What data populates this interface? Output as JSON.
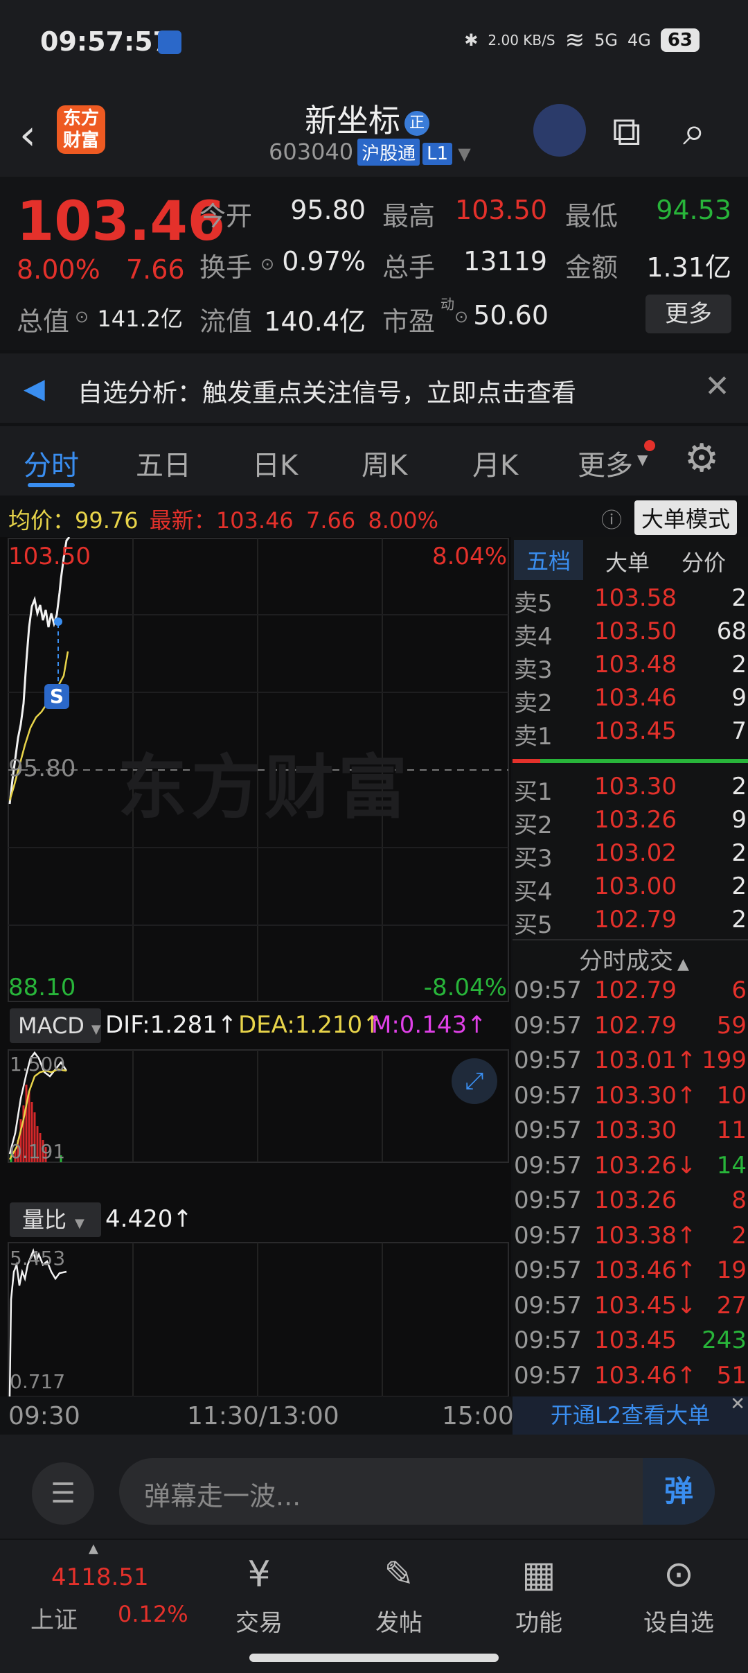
{
  "status_bar": {
    "time": "09:57:57",
    "net_speed": "2.00 KB/S",
    "signal_5g": "5G",
    "signal_4g": "4G",
    "battery": "63"
  },
  "header": {
    "title": "新坐标",
    "badge": "正",
    "code": "603040",
    "tag1": "沪股通",
    "tag2": "L1"
  },
  "logo": {
    "line1": "东方",
    "line2": "财富"
  },
  "quote": {
    "price": "103.46",
    "change_pct": "8.00%",
    "change": "7.66",
    "open_label": "今开",
    "open": "95.80",
    "high_label": "最高",
    "high": "103.50",
    "low_label": "最低",
    "low": "94.53",
    "turnover_label": "换手",
    "turnover": "0.97%",
    "volume_label": "总手",
    "volume": "13119",
    "amount_label": "金额",
    "amount": "1.31亿",
    "mktcap_label": "总值",
    "mktcap": "141.2亿",
    "float_label": "流值",
    "float": "140.4亿",
    "pe_label": "市盈",
    "pe_sup": "动",
    "pe": "50.60",
    "more": "更多"
  },
  "notice": {
    "text": "自选分析：触发重点关注信号，立即点击查看"
  },
  "tabs": [
    "分时",
    "五日",
    "日K",
    "周K",
    "月K",
    "更多"
  ],
  "info_bar": {
    "avg_label": "均价：",
    "avg": "99.76",
    "latest_label": "最新：",
    "latest": "103.46",
    "chg": "7.66",
    "pct": "8.00%",
    "mode": "大单模式"
  },
  "chart": {
    "top_price": "103.50",
    "top_pct": "8.04%",
    "mid_price": "95.80",
    "bottom_price": "88.10",
    "bottom_pct": "-8.04%",
    "watermark": "东方财富",
    "signal": "S",
    "macd_label": "MACD",
    "dif": "DIF:1.281↑",
    "dea": "DEA:1.210↑",
    "m": "M:0.143↑",
    "macd_top": "1.500",
    "macd_bottom": "0.191",
    "vr_label": "量比",
    "vr": "4.420↑",
    "vr_top": "5.453",
    "vr_bottom": "0.717",
    "x_start": "09:30",
    "x_mid": "11:30/13:00",
    "x_end": "15:00"
  },
  "orderbook": {
    "tabs": [
      "五档",
      "大单",
      "分价"
    ],
    "sells": [
      {
        "label": "卖5",
        "price": "103.58",
        "vol": "2"
      },
      {
        "label": "卖4",
        "price": "103.50",
        "vol": "68"
      },
      {
        "label": "卖3",
        "price": "103.48",
        "vol": "2"
      },
      {
        "label": "卖2",
        "price": "103.46",
        "vol": "9"
      },
      {
        "label": "卖1",
        "price": "103.45",
        "vol": "7"
      }
    ],
    "buys": [
      {
        "label": "买1",
        "price": "103.30",
        "vol": "2"
      },
      {
        "label": "买2",
        "price": "103.26",
        "vol": "9"
      },
      {
        "label": "买3",
        "price": "103.02",
        "vol": "2"
      },
      {
        "label": "买4",
        "price": "103.00",
        "vol": "2"
      },
      {
        "label": "买5",
        "price": "102.79",
        "vol": "2"
      }
    ],
    "trades_title": "分时成交",
    "trades": [
      {
        "time": "09:57",
        "price": "102.79",
        "vol": "6",
        "vc": "red"
      },
      {
        "time": "09:57",
        "price": "102.79",
        "vol": "59",
        "vc": "red"
      },
      {
        "time": "09:57",
        "price": "103.01↑",
        "vol": "199",
        "vc": "red"
      },
      {
        "time": "09:57",
        "price": "103.30↑",
        "vol": "10",
        "vc": "red"
      },
      {
        "time": "09:57",
        "price": "103.30",
        "vol": "11",
        "vc": "red"
      },
      {
        "time": "09:57",
        "price": "103.26↓",
        "vol": "14",
        "vc": "green"
      },
      {
        "time": "09:57",
        "price": "103.26",
        "vol": "8",
        "vc": "red"
      },
      {
        "time": "09:57",
        "price": "103.38↑",
        "vol": "2",
        "vc": "red"
      },
      {
        "time": "09:57",
        "price": "103.46↑",
        "vol": "19",
        "vc": "red"
      },
      {
        "time": "09:57",
        "price": "103.45↓",
        "vol": "27",
        "vc": "red"
      },
      {
        "time": "09:57",
        "price": "103.45",
        "vol": "243",
        "vc": "green"
      },
      {
        "time": "09:57",
        "price": "103.46↑",
        "vol": "51",
        "vc": "red"
      }
    ],
    "l2": "开通L2查看大单"
  },
  "comment": {
    "placeholder": "弹幕走一波...",
    "dan": "弹"
  },
  "bottom_nav": {
    "index_value": "4118.51",
    "index_name": "上证",
    "index_pct": "0.12%",
    "items": [
      "交易",
      "发帖",
      "功能",
      "设自选"
    ]
  },
  "colors": {
    "up": "#e4312b",
    "down": "#28b53a",
    "accent": "#3a8ef0",
    "avg_line": "#e8d44a"
  }
}
